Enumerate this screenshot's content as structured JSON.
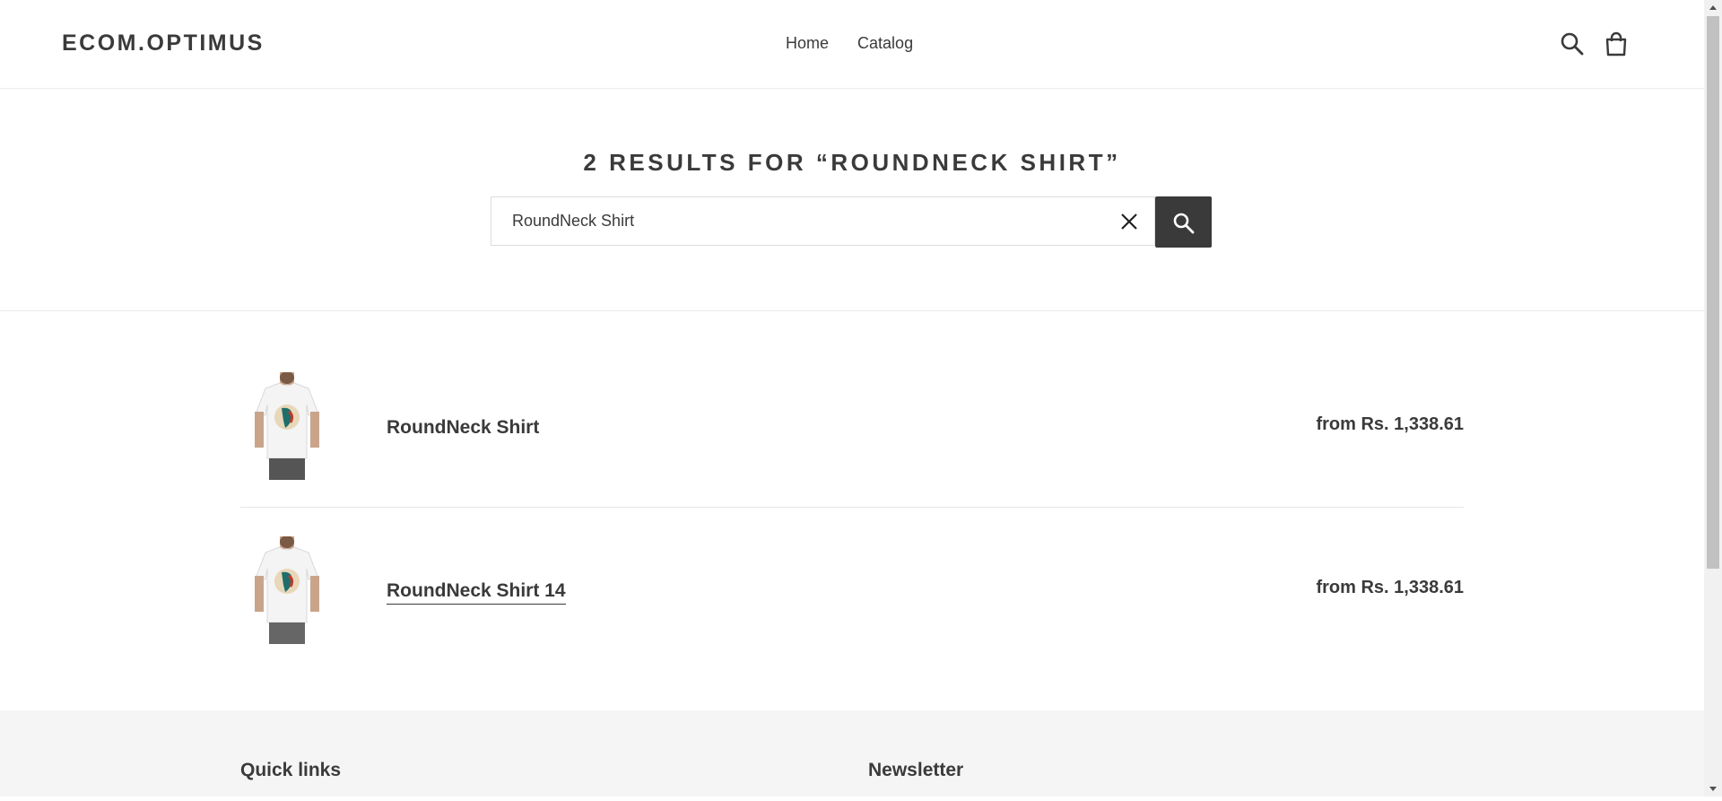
{
  "header": {
    "logo": "ECOM.OPTIMUS",
    "nav": [
      "Home",
      "Catalog"
    ],
    "icons": [
      "search-icon",
      "cart-icon"
    ]
  },
  "search": {
    "heading": "2 RESULTS FOR “ROUNDNECK SHIRT”",
    "value": "RoundNeck Shirt",
    "clear_icon": "close-icon",
    "submit_icon": "search-icon"
  },
  "results": [
    {
      "title": "RoundNeck Shirt",
      "price": "from Rs. 1,338.61"
    },
    {
      "title": "RoundNeck Shirt 14",
      "price": "from Rs. 1,338.61"
    }
  ],
  "footer": {
    "col1": "Quick links",
    "col2": "Newsletter"
  },
  "colors": {
    "text": "#3a3a3a",
    "button_bg": "#3a3a3a",
    "footer_bg": "#f5f5f5"
  }
}
